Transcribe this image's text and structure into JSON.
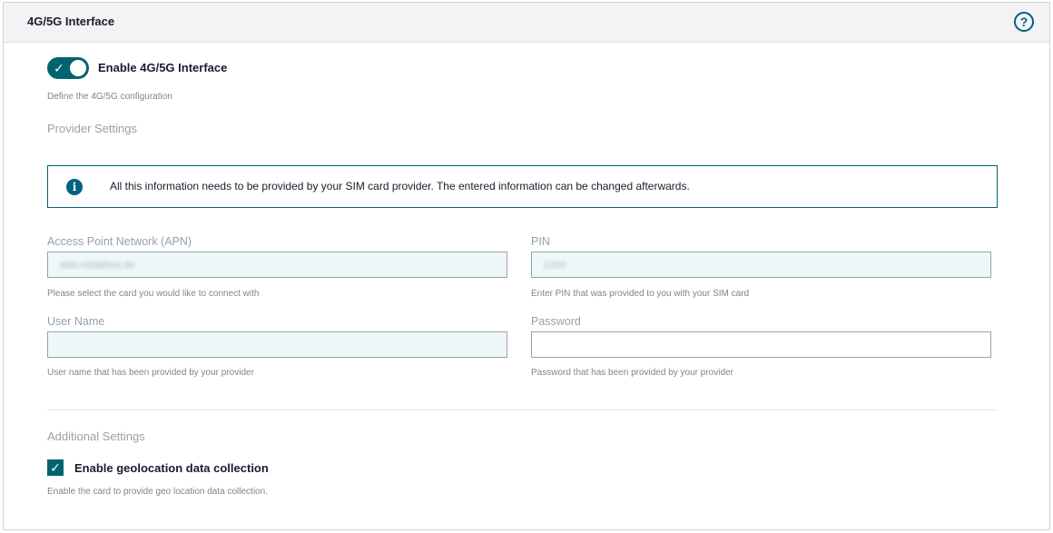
{
  "header": {
    "title": "4G/5G Interface",
    "help_icon": "help-circle-icon",
    "help_glyph": "?"
  },
  "toggle": {
    "label": "Enable 4G/5G Interface",
    "checked": true,
    "check_glyph": "✓",
    "description": "Define the 4G/5G configuration"
  },
  "provider": {
    "section_title": "Provider Settings",
    "info_icon": "info-icon",
    "info_glyph": "i",
    "info_text": "All this information needs to be provided by your SIM card provider. The entered information can be changed afterwards."
  },
  "fields": {
    "apn": {
      "label": "Access Point Network (APN)",
      "value": "web.vodafone.de",
      "hint": "Please select the card you would like to connect with"
    },
    "pin": {
      "label": "PIN",
      "value": "1234",
      "hint": "Enter PIN that was provided to you with your SIM card"
    },
    "username": {
      "label": "User Name",
      "value": "",
      "hint": "User name that has been provided by your provider"
    },
    "password": {
      "label": "Password",
      "value": "",
      "hint": "Password that has been provided by your provider"
    }
  },
  "additional": {
    "section_title": "Additional Settings",
    "geolocation_label": "Enable geolocation data collection",
    "geolocation_checked": true,
    "check_glyph": "✓",
    "geolocation_hint": "Enable the card to provide geo location data collection."
  },
  "colors": {
    "accent": "#00646e",
    "info_border": "#00646e",
    "input_fill": "#eef8fa"
  }
}
